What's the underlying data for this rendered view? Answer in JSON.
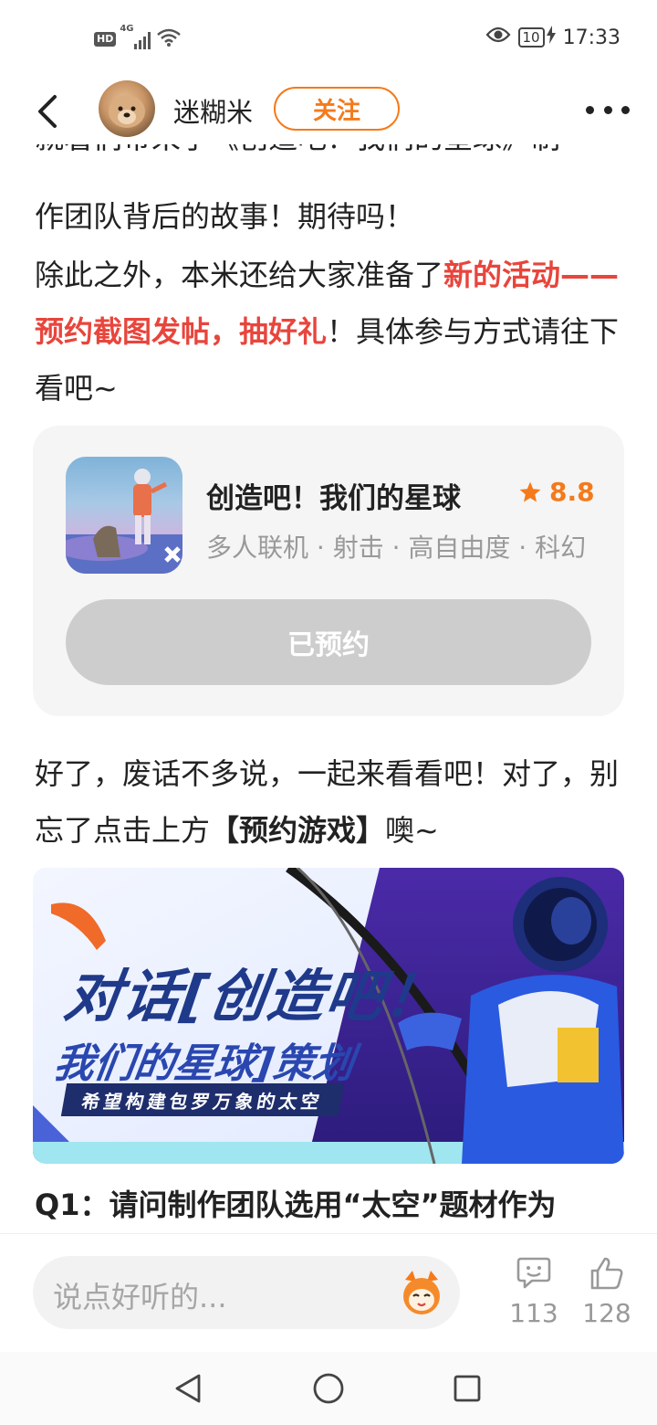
{
  "status_bar": {
    "network_badge": "HD",
    "signal_label": "4G",
    "battery": "10",
    "time": "17:33"
  },
  "header": {
    "username": "迷糊米",
    "follow_label": "关注"
  },
  "article": {
    "p_cut": "就着们带来了《创造吧！我们的星球》制",
    "p1": "作团队背后的故事！期待吗！",
    "p2_a": "除此之外，本米还给大家准备了",
    "p2_b": "新的活动——预约截图发帖，抽好礼",
    "p2_c": "！具体参与方式请往下看吧~",
    "p3_a": "好了，废话不多说，一起来看看吧！对了，别忘了点击上方",
    "p3_b": "【预约游戏】",
    "p3_c": "噢~",
    "q1": "Q1：请问制作团队选用“太空”题材作为"
  },
  "game_card": {
    "name": "创造吧！我们的星球",
    "rating": "8.8",
    "tags": "多人联机 · 射击 · 高自由度 · 科幻",
    "button_label": "已预约"
  },
  "banner": {
    "title_line1": "对话[创造吧！",
    "title_line2": "我们的星球]策划",
    "subtitle": "希望构建包罗万象的太空"
  },
  "comment_bar": {
    "placeholder": "说点好听的...",
    "comment_count": "113",
    "like_count": "128"
  },
  "colors": {
    "accent": "#f47a1b",
    "highlight": "#e8453c",
    "card_bg": "#f5f5f5",
    "button_disabled": "#cdcdcd"
  },
  "icons": [
    "back-arrow-icon",
    "more-dots-icon",
    "star-icon",
    "mascot-icon",
    "comment-icon",
    "thumbs-up-icon",
    "nav-back-icon",
    "nav-home-icon",
    "nav-recents-icon"
  ]
}
